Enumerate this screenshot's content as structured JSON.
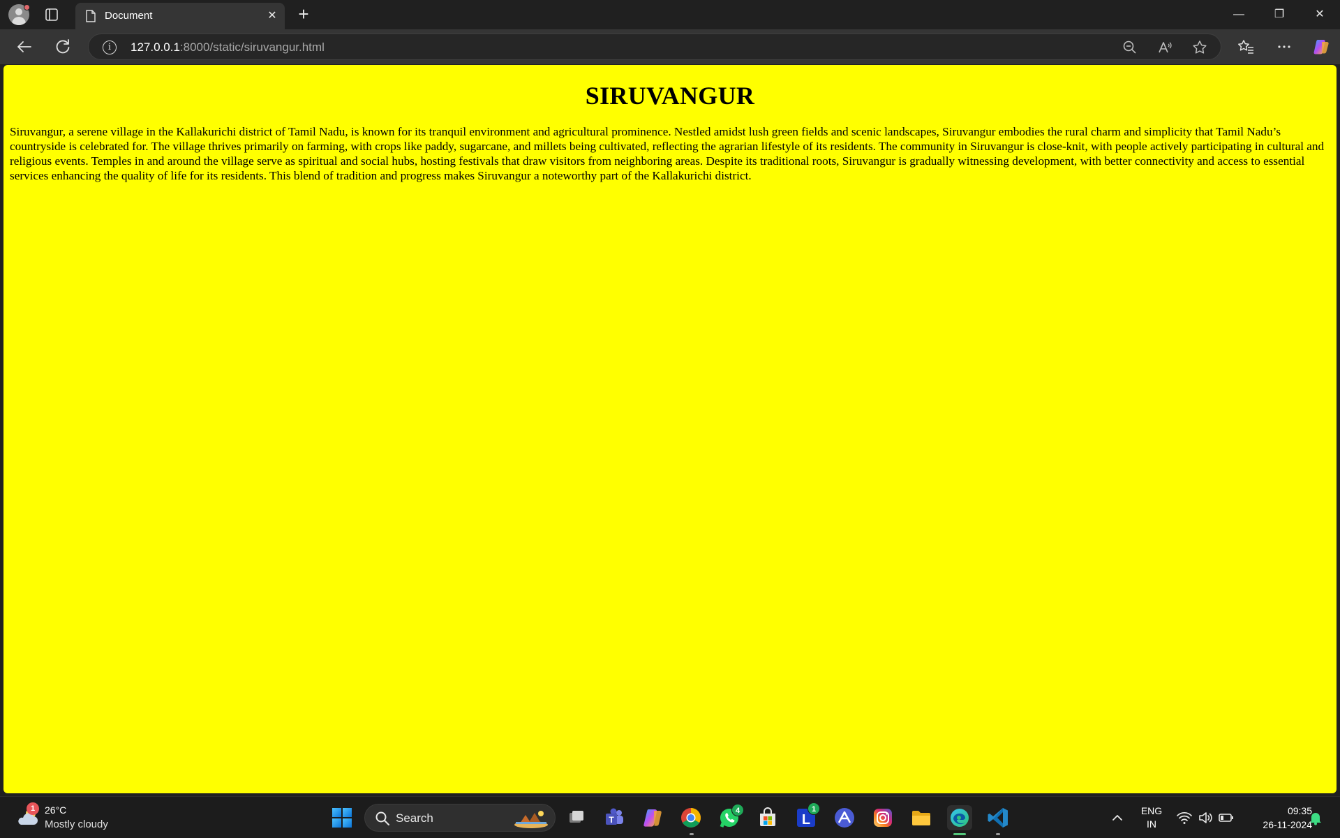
{
  "browser": {
    "tab": {
      "title": "Document"
    },
    "address": {
      "host": "127.0.0.1",
      "path": ":8000/static/siruvangur.html"
    }
  },
  "page": {
    "heading": "SIRUVANGUR",
    "paragraph": "Siruvangur, a serene village in the Kallakurichi district of Tamil Nadu, is known for its tranquil environment and agricultural prominence. Nestled amidst lush green fields and scenic landscapes, Siruvangur embodies the rural charm and simplicity that Tamil Nadu’s countryside is celebrated for. The village thrives primarily on farming, with crops like paddy, sugarcane, and millets being cultivated, reflecting the agrarian lifestyle of its residents. The community in Siruvangur is close-knit, with people actively participating in cultural and religious events. Temples in and around the village serve as spiritual and social hubs, hosting festivals that draw visitors from neighboring areas. Despite its traditional roots, Siruvangur is gradually witnessing development, with better connectivity and access to essential services enhancing the quality of life for its residents. This blend of tradition and progress makes Siruvangur a noteworthy part of the Kallakurichi district.",
    "background_color": "#ffff00"
  },
  "taskbar": {
    "weather": {
      "badge": "1",
      "temperature": "26°C",
      "condition": "Mostly cloudy"
    },
    "search_label": "Search",
    "apps": [
      {
        "name": "task-view",
        "badge": ""
      },
      {
        "name": "teams",
        "badge": ""
      },
      {
        "name": "copilot",
        "badge": ""
      },
      {
        "name": "chrome",
        "badge": ""
      },
      {
        "name": "whatsapp",
        "badge": "4"
      },
      {
        "name": "microsoft-store",
        "badge": ""
      },
      {
        "name": "l-app",
        "badge": "1"
      },
      {
        "name": "arc-app",
        "badge": ""
      },
      {
        "name": "instagram",
        "badge": ""
      },
      {
        "name": "file-explorer",
        "badge": ""
      },
      {
        "name": "edge",
        "badge": ""
      },
      {
        "name": "vscode",
        "badge": ""
      }
    ],
    "language": {
      "line1": "ENG",
      "line2": "IN"
    },
    "clock": {
      "time": "09:35",
      "date": "26-11-2024"
    }
  },
  "colors": {
    "accent_yellow": "#ffff00",
    "chrome_dark": "#202020",
    "toolbar": "#353535"
  }
}
